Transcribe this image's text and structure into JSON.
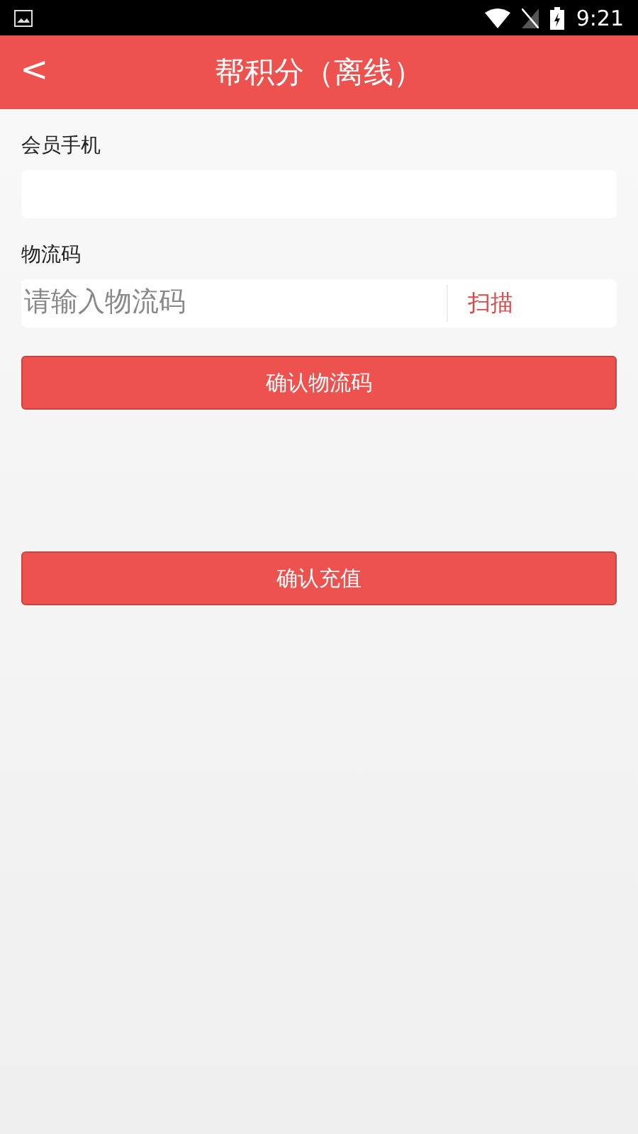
{
  "status_bar": {
    "time": "9:21"
  },
  "header": {
    "back": "<",
    "title": "帮积分（离线）"
  },
  "member_phone": {
    "label": "会员手机"
  },
  "logistics_code": {
    "label": "物流码",
    "placeholder": "请输入物流码",
    "scan": "扫描"
  },
  "buttons": [
    "确认物流码",
    "确认充值"
  ]
}
